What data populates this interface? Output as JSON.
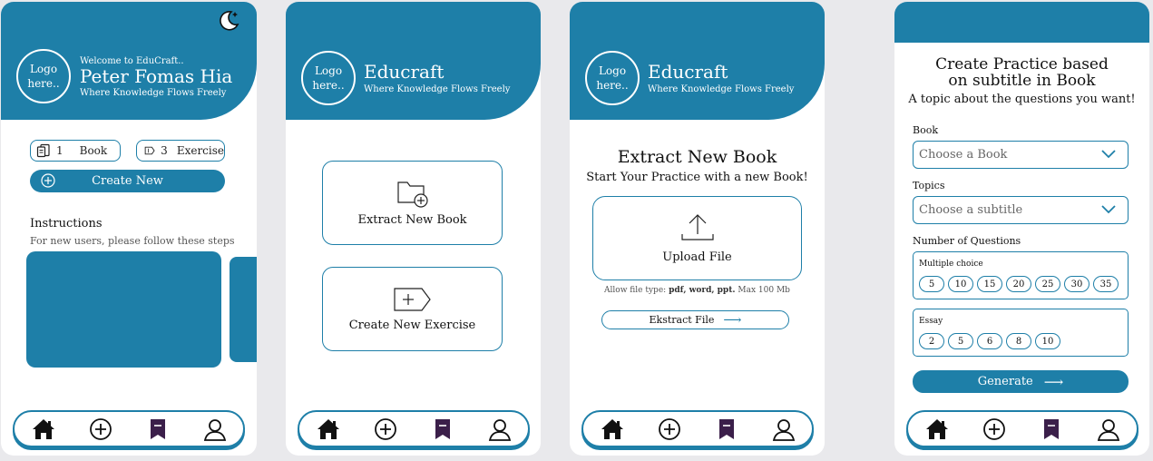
{
  "colors": {
    "primary": "#1e7fa8",
    "background": "#e9e9ec",
    "surface": "#ffffff"
  },
  "common": {
    "logo_line1": "Logo",
    "logo_line2": "here..",
    "brand": "Educraft",
    "tagline": "Where Knowledge Flows Freely",
    "nav": {
      "items": [
        "home-icon",
        "add-circle-icon",
        "bookmark-icon",
        "profile-icon"
      ],
      "active": "bookmark-icon"
    }
  },
  "home": {
    "theme_icon": "moon-icon",
    "welcome": "Welcome to EduCraft..",
    "user_name": "Peter Fomas Hia",
    "book_count": "1",
    "book_label": "Book",
    "exercise_count": "3",
    "exercise_label": "Exercise",
    "create_label": "Create New",
    "instructions_title": "Instructions",
    "instructions_sub": "For new users, please follow these steps"
  },
  "create_menu": {
    "extract_label": "Extract New Book",
    "exercise_label": "Create New Exercise"
  },
  "extract": {
    "title": "Extract New Book",
    "subtitle": "Start Your Practice with a new Book!",
    "upload_label": "Upload File",
    "allow_prefix": "Allow file type:",
    "allow_types": "pdf, word, ppt.",
    "allow_suffix": "Max 100 Mb",
    "extract_button": "Ekstract File"
  },
  "practice": {
    "title_line1": "Create Practice based",
    "title_line2": "on subtitle in Book",
    "subtitle": "A topic about the questions you want!",
    "book_label": "Book",
    "book_placeholder": "Choose a Book",
    "topics_label": "Topics",
    "topics_placeholder": "Choose a subtitle",
    "questions_label": "Number of Questions",
    "multiple_choice_label": "Multiple choice",
    "multiple_choice_options": [
      "5",
      "10",
      "15",
      "20",
      "25",
      "30",
      "35"
    ],
    "essay_label": "Essay",
    "essay_options": [
      "2",
      "5",
      "6",
      "8",
      "10"
    ],
    "generate_label": "Generate"
  }
}
